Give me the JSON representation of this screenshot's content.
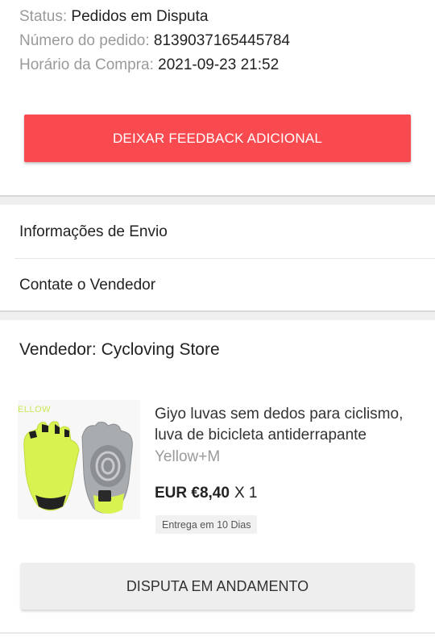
{
  "order": {
    "status_label": "Status: ",
    "status_value": "Pedidos em Disputa",
    "number_label": "Número do pedido: ",
    "number_value": "8139037165445784",
    "time_label": "Horário da Compra: ",
    "time_value": "2021-09-23 21:52"
  },
  "actions": {
    "feedback_label": "DEIXAR FEEDBACK ADICIONAL",
    "dispute_label": "DISPUTA EM ANDAMENTO"
  },
  "menu": {
    "shipping_label": "Informações de Envio",
    "contact_label": "Contate o Vendedor"
  },
  "seller": {
    "label": "Vendedor: Cycloving Store"
  },
  "product": {
    "image_text": "ELLOW",
    "title": "Giyo luvas sem dedos para ciclismo, luva de bicicleta antiderrapante",
    "variant": "Yellow+M",
    "price": "EUR €8,40",
    "quantity": "X 1",
    "delivery": "Entrega em 10 Dias"
  },
  "colors": {
    "accent": "#f94a4f",
    "glove_yellow": "#d8f34f",
    "glove_gray": "#8a8d90"
  }
}
